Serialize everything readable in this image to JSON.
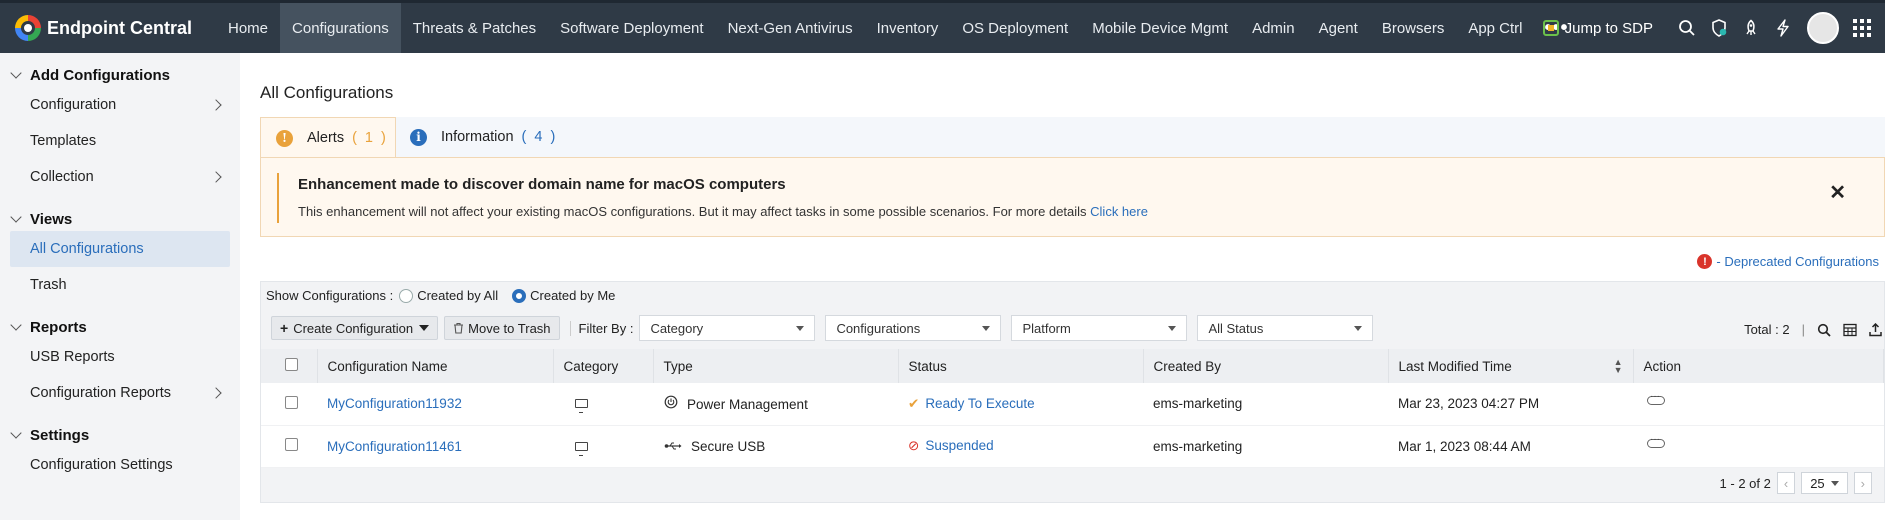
{
  "app": {
    "name": "Endpoint Central"
  },
  "nav": {
    "items": [
      "Home",
      "Configurations",
      "Threats & Patches",
      "Software Deployment",
      "Next-Gen Antivirus",
      "Inventory",
      "OS Deployment",
      "Mobile Device Mgmt",
      "Admin",
      "Agent",
      "Browsers",
      "App Ctrl"
    ],
    "active": "Configurations",
    "more": "•••",
    "jump_sdp": "Jump to SDP"
  },
  "sidebar": {
    "sections": [
      {
        "title": "Add Configurations",
        "items": [
          {
            "label": "Configuration",
            "arrow": true
          },
          {
            "label": "Templates",
            "arrow": false
          },
          {
            "label": "Collection",
            "arrow": true
          }
        ]
      },
      {
        "title": "Views",
        "items": [
          {
            "label": "All Configurations",
            "active": true
          },
          {
            "label": "Trash"
          }
        ]
      },
      {
        "title": "Reports",
        "items": [
          {
            "label": "USB Reports"
          },
          {
            "label": "Configuration Reports",
            "arrow": true
          }
        ]
      },
      {
        "title": "Settings",
        "items": [
          {
            "label": "Configuration Settings"
          }
        ]
      }
    ]
  },
  "main": {
    "title": "All Configurations",
    "tabs": [
      {
        "label": "Alerts",
        "count": "( 1 )",
        "icon": "alert-icon",
        "color": "#e9a23b"
      },
      {
        "label": "Information",
        "count": "( 4 )",
        "icon": "info-icon",
        "color": "#2a6ebb"
      }
    ],
    "alert": {
      "title": "Enhancement made to discover domain name for macOS computers",
      "text": "This enhancement will not affect your existing macOS configurations. But it may affect tasks in some possible scenarios. For more details ",
      "link": "Click here"
    },
    "deprecated_label": "- Deprecated Configurations",
    "show": {
      "label": "Show Configurations :",
      "options": [
        "Created by All",
        "Created by Me"
      ],
      "selected": "Created by Me"
    },
    "toolbar": {
      "create": "Create Configuration",
      "trash": "Move to Trash",
      "filter_label": "Filter By :",
      "filters": [
        "Category",
        "Configurations",
        "Platform",
        "All Status"
      ],
      "total": "Total : 2"
    },
    "table": {
      "columns": [
        "Configuration Name",
        "Category",
        "Type",
        "Status",
        "Created By",
        "Last Modified Time",
        "Action"
      ],
      "rows": [
        {
          "name": "MyConfiguration11932",
          "type": "Power Management",
          "type_icon": "power-icon",
          "status": "Ready To Execute",
          "status_icon": "check-icon",
          "created_by": "ems-marketing",
          "modified": "Mar 23, 2023 04:27 PM"
        },
        {
          "name": "MyConfiguration11461",
          "type": "Secure USB",
          "type_icon": "usb-icon",
          "status": "Suspended",
          "status_icon": "suspended-icon",
          "created_by": "ems-marketing",
          "modified": "Mar 1, 2023 08:44 AM"
        }
      ]
    },
    "pager": {
      "range": "1 - 2 of 2",
      "per_page": "25"
    }
  }
}
